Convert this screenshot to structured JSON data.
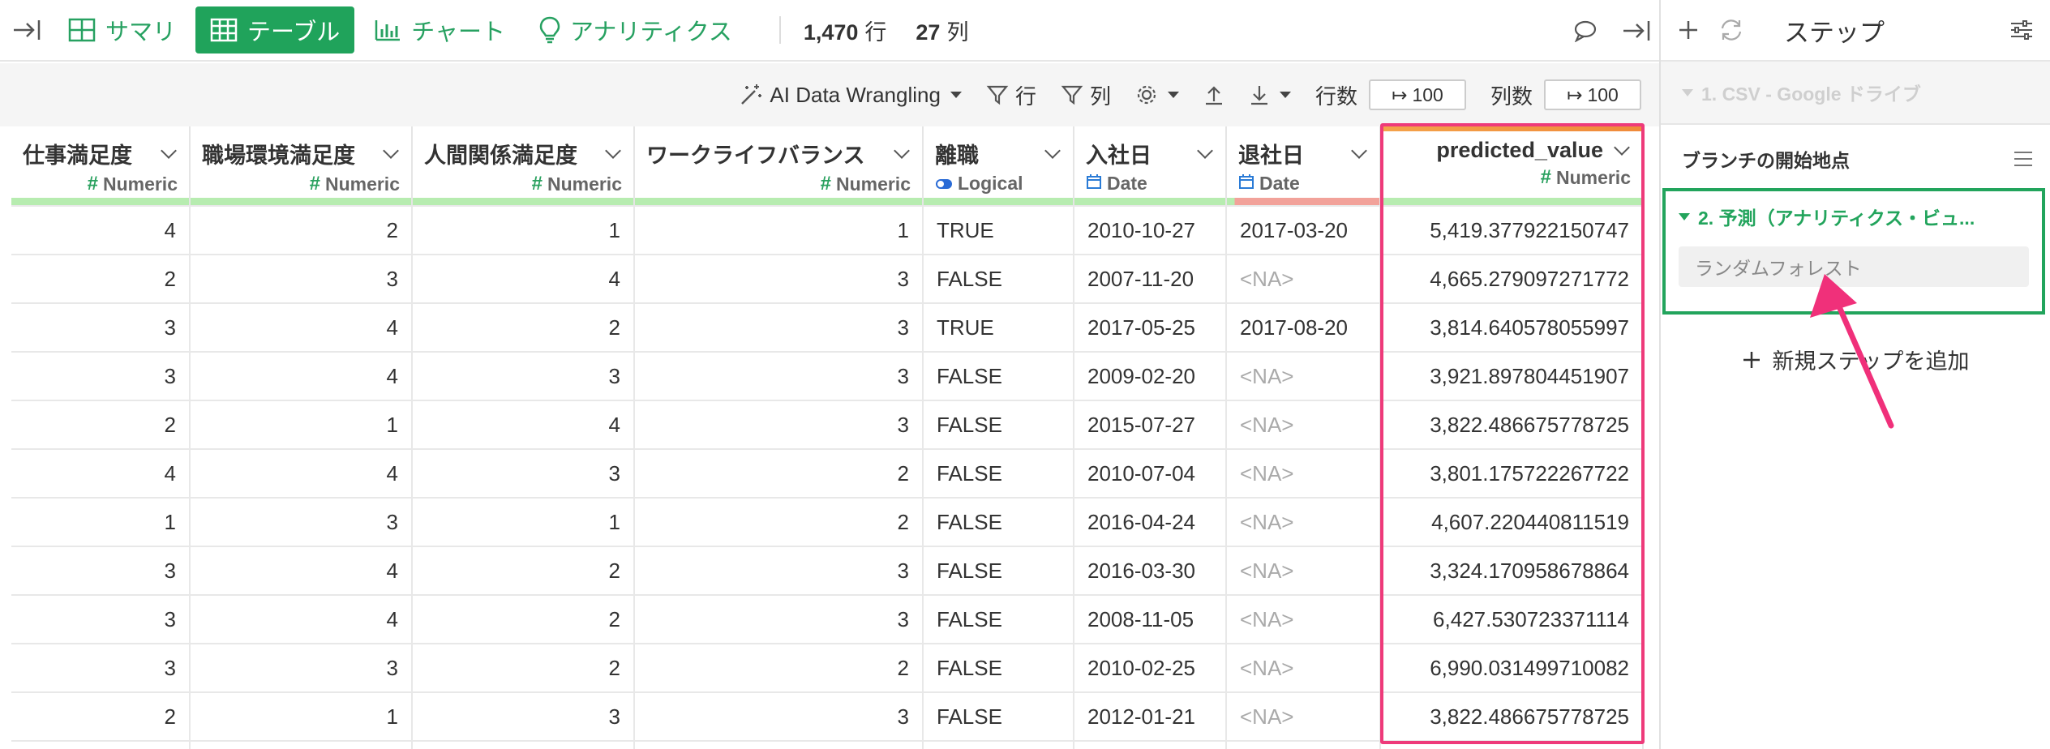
{
  "toolbar": {
    "tabs": [
      {
        "label": "サマリ",
        "icon": "summary-grid-icon"
      },
      {
        "label": "テーブル",
        "icon": "table-icon",
        "active": true
      },
      {
        "label": "チャート",
        "icon": "chart-icon"
      },
      {
        "label": "アナリティクス",
        "icon": "lightbulb-icon"
      }
    ],
    "rows_count": "1,470",
    "rows_unit": "行",
    "cols_count": "27",
    "cols_unit": "列"
  },
  "toolbar2": {
    "ai_label": "AI Data Wrangling",
    "filter_rows_label": "行",
    "filter_cols_label": "列",
    "rows_label": "行数",
    "rows_value": "100",
    "cols_label": "列数",
    "cols_value": "100"
  },
  "table": {
    "columns": [
      {
        "name": "仕事満足度",
        "type": "Numeric"
      },
      {
        "name": "職場環境満足度",
        "type": "Numeric"
      },
      {
        "name": "人間関係満足度",
        "type": "Numeric"
      },
      {
        "name": "ワークライフバランス",
        "type": "Numeric"
      },
      {
        "name": "離職",
        "type": "Logical"
      },
      {
        "name": "入社日",
        "type": "Date"
      },
      {
        "name": "退社日",
        "type": "Date"
      },
      {
        "name": "predicted_value",
        "type": "Numeric"
      }
    ],
    "rows": [
      [
        "4",
        "2",
        "1",
        "1",
        "TRUE",
        "2010-10-27",
        "2017-03-20",
        "5,419.377922150747"
      ],
      [
        "2",
        "3",
        "4",
        "3",
        "FALSE",
        "2007-11-20",
        "<NA>",
        "4,665.279097271772"
      ],
      [
        "3",
        "4",
        "2",
        "3",
        "TRUE",
        "2017-05-25",
        "2017-08-20",
        "3,814.640578055997"
      ],
      [
        "3",
        "4",
        "3",
        "3",
        "FALSE",
        "2009-02-20",
        "<NA>",
        "3,921.897804451907"
      ],
      [
        "2",
        "1",
        "4",
        "3",
        "FALSE",
        "2015-07-27",
        "<NA>",
        "3,822.486675778725"
      ],
      [
        "4",
        "4",
        "3",
        "2",
        "FALSE",
        "2010-07-04",
        "<NA>",
        "3,801.175722267722"
      ],
      [
        "1",
        "3",
        "1",
        "2",
        "FALSE",
        "2016-04-24",
        "<NA>",
        "4,607.220440811519"
      ],
      [
        "3",
        "4",
        "2",
        "3",
        "FALSE",
        "2016-03-30",
        "<NA>",
        "3,324.170958678864"
      ],
      [
        "3",
        "4",
        "2",
        "3",
        "FALSE",
        "2008-11-05",
        "<NA>",
        "6,427.530723371114"
      ],
      [
        "3",
        "3",
        "2",
        "2",
        "FALSE",
        "2010-02-25",
        "<NA>",
        "6,990.031499710082"
      ],
      [
        "2",
        "1",
        "3",
        "3",
        "FALSE",
        "2012-01-21",
        "<NA>",
        "3,822.486675778725"
      ]
    ]
  },
  "panel": {
    "title": "ステップ",
    "step1_label": "1. CSV - Google ドライブ",
    "branch_label": "ブランチの開始地点",
    "step2_label": "2. 予測（アナリティクス・ビュ...",
    "step2_sub": "ランダムフォレスト",
    "add_step_label": "新規ステップを追加"
  },
  "colors": {
    "accent_green": "#20a35b",
    "highlight_pink": "#ee3a7a"
  }
}
